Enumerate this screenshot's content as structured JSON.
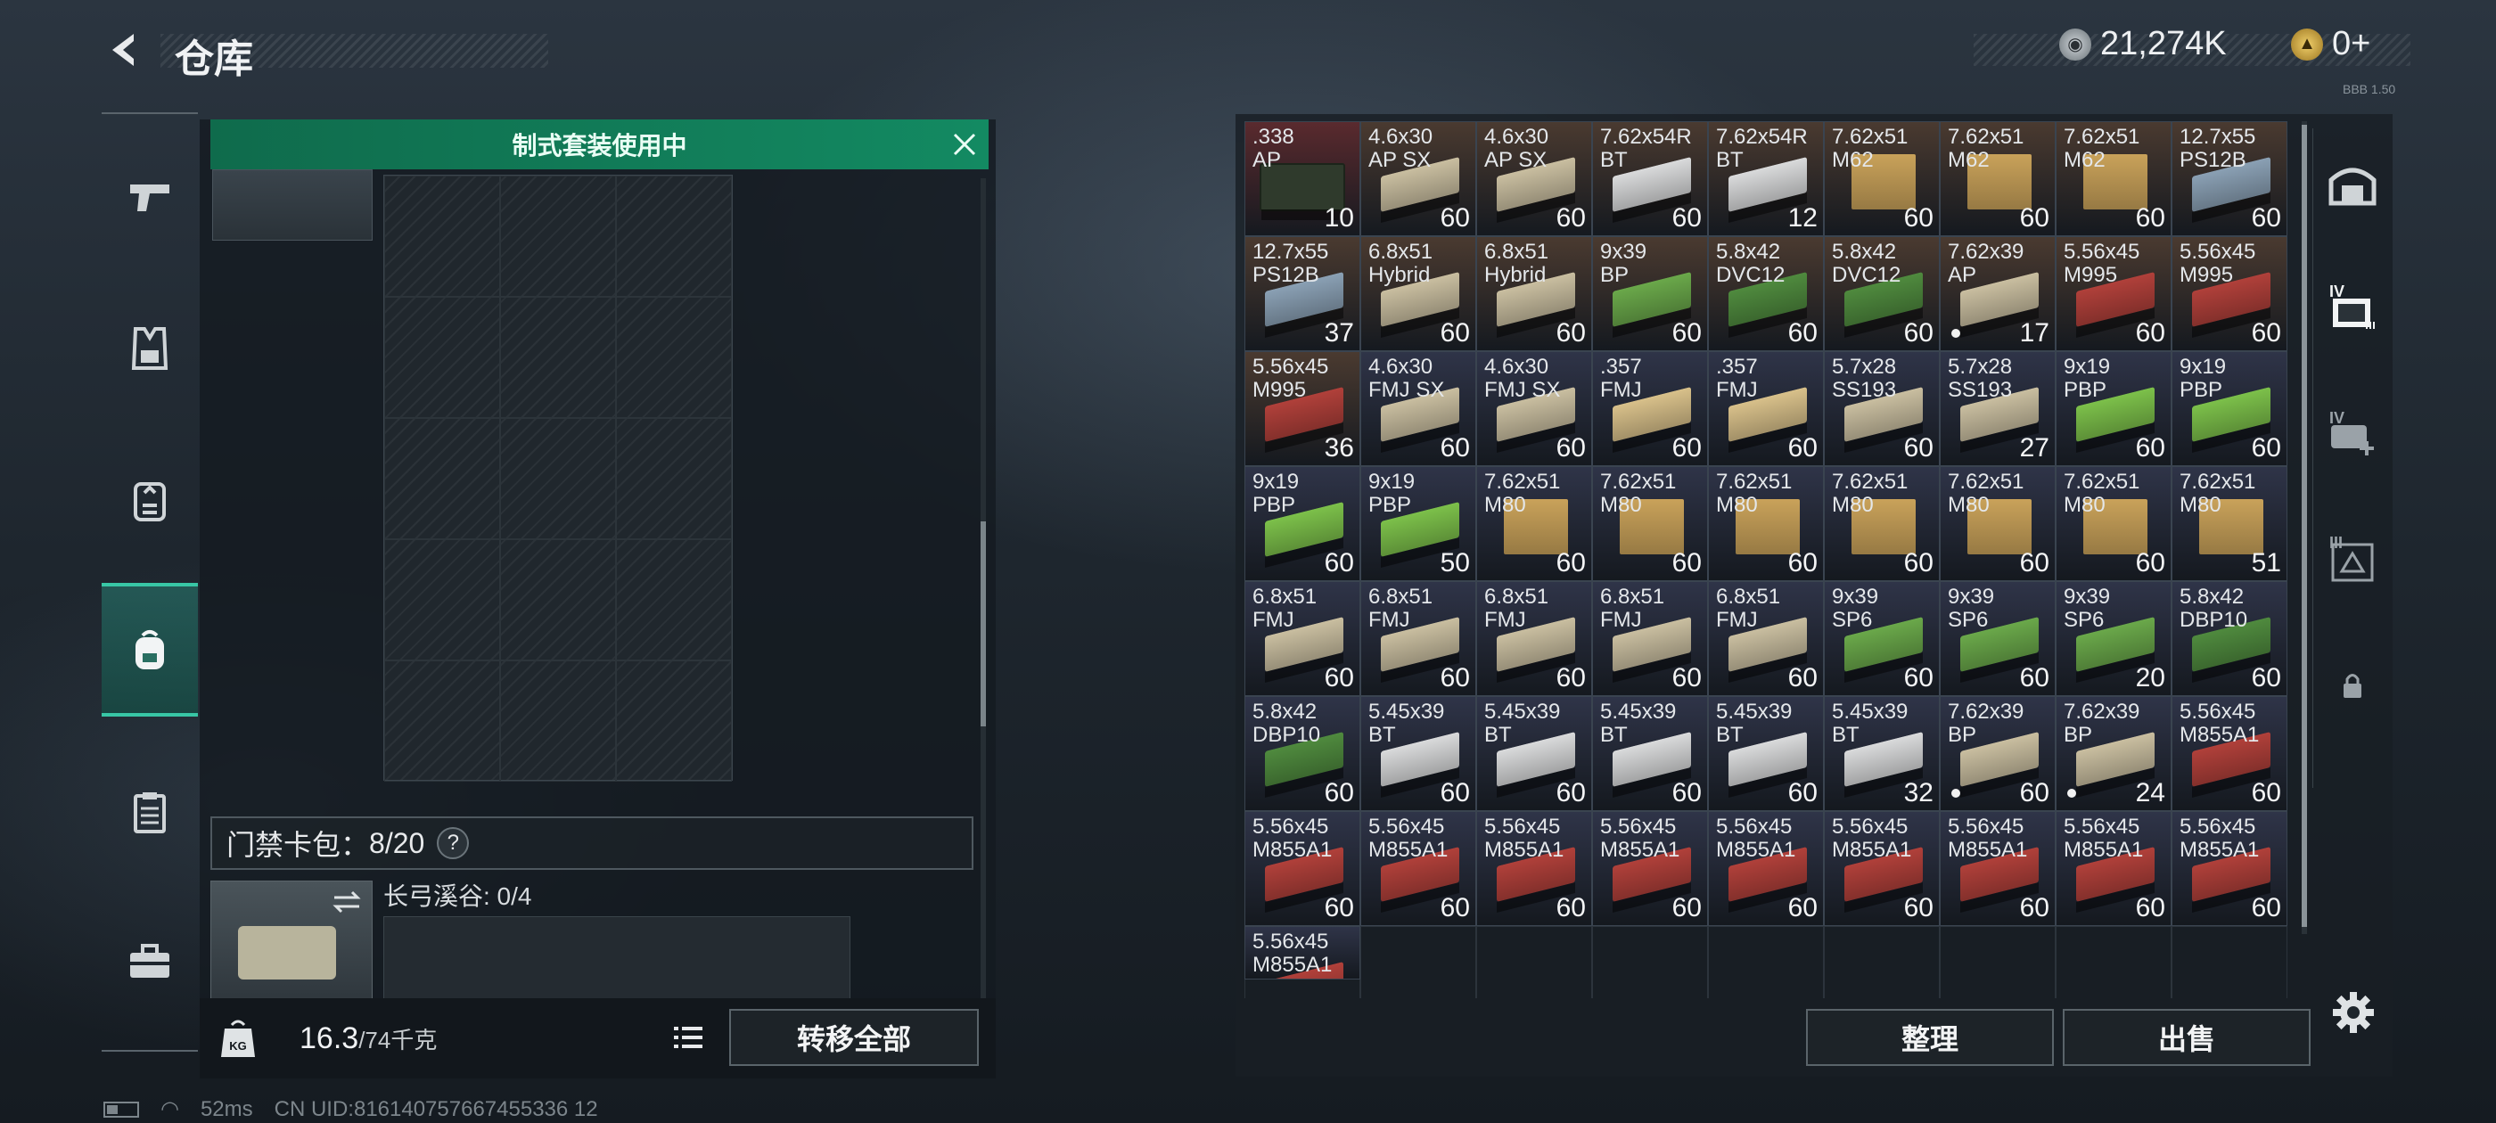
{
  "header": {
    "title": "仓库",
    "currency": [
      {
        "icon": "silver-coin-icon",
        "value": "21,274K"
      },
      {
        "icon": "gold-coin-icon",
        "value": "0+"
      }
    ],
    "version": "BBB 1.50"
  },
  "sidebar": {
    "items": [
      {
        "name": "weapon-tab",
        "icon": "pistol-icon"
      },
      {
        "name": "armor-tab",
        "icon": "vest-icon"
      },
      {
        "name": "rig-tab",
        "icon": "rig-icon"
      },
      {
        "name": "backpack-tab",
        "icon": "backpack-icon",
        "active": true
      },
      {
        "name": "case-tab",
        "icon": "case-icon"
      },
      {
        "name": "toolbox-tab",
        "icon": "toolbox-icon"
      }
    ]
  },
  "left_panel": {
    "banner": "制式套装使用中",
    "keycard_label": "门禁卡包：",
    "keycard_value": "8/20",
    "help": "?",
    "key_name": "长弓溪谷: 0/4",
    "weight_value": "16.3",
    "weight_unit": "/74千克",
    "weight_badge": "KG",
    "transfer_all": "转移全部"
  },
  "inventory": {
    "items": [
      {
        "l1": ".338",
        "l2": "AP",
        "n": "10",
        "c": "#2f3a2c",
        "bg": "#5a2a2e",
        "k": "ammocan"
      },
      {
        "l1": "4.6x30",
        "l2": "AP SX",
        "n": "60",
        "c": "#c9bea0",
        "bg": "#4a3a30"
      },
      {
        "l1": "4.6x30",
        "l2": "AP SX",
        "n": "60",
        "c": "#c9bea0",
        "bg": "#4a3a30"
      },
      {
        "l1": "7.62x54R",
        "l2": "BT",
        "n": "60",
        "c": "#d9dadb",
        "bg": "#4a3a30"
      },
      {
        "l1": "7.62x54R",
        "l2": "BT",
        "n": "12",
        "c": "#d9dadb",
        "bg": "#4a3a30"
      },
      {
        "l1": "7.62x51",
        "l2": "M62",
        "n": "60",
        "c": "#c9a25a",
        "bg": "#4a3a30",
        "k": "crate"
      },
      {
        "l1": "7.62x51",
        "l2": "M62",
        "n": "60",
        "c": "#c9a25a",
        "bg": "#4a3a30",
        "k": "crate"
      },
      {
        "l1": "7.62x51",
        "l2": "M62",
        "n": "60",
        "c": "#c9a25a",
        "bg": "#4a3a30",
        "k": "crate"
      },
      {
        "l1": "12.7x55",
        "l2": "PS12B",
        "n": "60",
        "c": "#8aa0b4",
        "bg": "#4a3a30"
      },
      {
        "l1": "12.7x55",
        "l2": "PS12B",
        "n": "37",
        "c": "#8aa0b4",
        "bg": "#4a3a30"
      },
      {
        "l1": "6.8x51",
        "l2": "Hybrid",
        "n": "60",
        "c": "#c9bea0",
        "bg": "#4a3a30"
      },
      {
        "l1": "6.8x51",
        "l2": "Hybrid",
        "n": "60",
        "c": "#c9bea0",
        "bg": "#4a3a30"
      },
      {
        "l1": "9x39",
        "l2": "BP",
        "n": "60",
        "c": "#6aa84a",
        "bg": "#4a3a30"
      },
      {
        "l1": "5.8x42",
        "l2": "DVC12",
        "n": "60",
        "c": "#4f8a3e",
        "bg": "#4a3a30"
      },
      {
        "l1": "5.8x42",
        "l2": "DVC12",
        "n": "60",
        "c": "#4f8a3e",
        "bg": "#4a3a30"
      },
      {
        "l1": "7.62x39",
        "l2": "AP",
        "n": "17",
        "c": "#c9bea0",
        "bg": "#4a3a30",
        "dot": true
      },
      {
        "l1": "5.56x45",
        "l2": "M995",
        "n": "60",
        "c": "#b0403a",
        "bg": "#4a3a30"
      },
      {
        "l1": "5.56x45",
        "l2": "M995",
        "n": "60",
        "c": "#b0403a",
        "bg": "#4a3a30"
      },
      {
        "l1": "5.56x45",
        "l2": "M995",
        "n": "36",
        "c": "#b0403a",
        "bg": "#4a3a30"
      },
      {
        "l1": "4.6x30",
        "l2": "FMJ SX",
        "n": "60",
        "c": "#c9bea0",
        "bg": "#2f3448"
      },
      {
        "l1": "4.6x30",
        "l2": "FMJ SX",
        "n": "60",
        "c": "#c9bea0",
        "bg": "#2f3448"
      },
      {
        "l1": ".357",
        "l2": "FMJ",
        "n": "60",
        "c": "#d8c08a",
        "bg": "#2f3448"
      },
      {
        "l1": ".357",
        "l2": "FMJ",
        "n": "60",
        "c": "#d8c08a",
        "bg": "#2f3448"
      },
      {
        "l1": "5.7x28",
        "l2": "SS193",
        "n": "60",
        "c": "#c9bea0",
        "bg": "#2f3448"
      },
      {
        "l1": "5.7x28",
        "l2": "SS193",
        "n": "27",
        "c": "#c9bea0",
        "bg": "#2f3448"
      },
      {
        "l1": "9x19",
        "l2": "PBP",
        "n": "60",
        "c": "#7cc04a",
        "bg": "#2f3448"
      },
      {
        "l1": "9x19",
        "l2": "PBP",
        "n": "60",
        "c": "#7cc04a",
        "bg": "#2f3448"
      },
      {
        "l1": "9x19",
        "l2": "PBP",
        "n": "60",
        "c": "#7cc04a",
        "bg": "#2f3448"
      },
      {
        "l1": "9x19",
        "l2": "PBP",
        "n": "50",
        "c": "#7cc04a",
        "bg": "#2f3448"
      },
      {
        "l1": "7.62x51",
        "l2": "M80",
        "n": "60",
        "c": "#c9a25a",
        "bg": "#2f3448",
        "k": "crate"
      },
      {
        "l1": "7.62x51",
        "l2": "M80",
        "n": "60",
        "c": "#c9a25a",
        "bg": "#2f3448",
        "k": "crate"
      },
      {
        "l1": "7.62x51",
        "l2": "M80",
        "n": "60",
        "c": "#c9a25a",
        "bg": "#2f3448",
        "k": "crate"
      },
      {
        "l1": "7.62x51",
        "l2": "M80",
        "n": "60",
        "c": "#c9a25a",
        "bg": "#2f3448",
        "k": "crate"
      },
      {
        "l1": "7.62x51",
        "l2": "M80",
        "n": "60",
        "c": "#c9a25a",
        "bg": "#2f3448",
        "k": "crate"
      },
      {
        "l1": "7.62x51",
        "l2": "M80",
        "n": "60",
        "c": "#c9a25a",
        "bg": "#2f3448",
        "k": "crate"
      },
      {
        "l1": "7.62x51",
        "l2": "M80",
        "n": "51",
        "c": "#c9a25a",
        "bg": "#2f3448",
        "k": "crate"
      },
      {
        "l1": "6.8x51",
        "l2": "FMJ",
        "n": "60",
        "c": "#c9bea0",
        "bg": "#2f3448"
      },
      {
        "l1": "6.8x51",
        "l2": "FMJ",
        "n": "60",
        "c": "#c9bea0",
        "bg": "#2f3448"
      },
      {
        "l1": "6.8x51",
        "l2": "FMJ",
        "n": "60",
        "c": "#c9bea0",
        "bg": "#2f3448"
      },
      {
        "l1": "6.8x51",
        "l2": "FMJ",
        "n": "60",
        "c": "#c9bea0",
        "bg": "#2f3448"
      },
      {
        "l1": "6.8x51",
        "l2": "FMJ",
        "n": "60",
        "c": "#c9bea0",
        "bg": "#2f3448"
      },
      {
        "l1": "9x39",
        "l2": "SP6",
        "n": "60",
        "c": "#6aa84a",
        "bg": "#2f3448"
      },
      {
        "l1": "9x39",
        "l2": "SP6",
        "n": "60",
        "c": "#6aa84a",
        "bg": "#2f3448"
      },
      {
        "l1": "9x39",
        "l2": "SP6",
        "n": "20",
        "c": "#6aa84a",
        "bg": "#2f3448"
      },
      {
        "l1": "5.8x42",
        "l2": "DBP10",
        "n": "60",
        "c": "#4f8a3e",
        "bg": "#2f3448"
      },
      {
        "l1": "5.8x42",
        "l2": "DBP10",
        "n": "60",
        "c": "#4f8a3e",
        "bg": "#2f3448"
      },
      {
        "l1": "5.45x39",
        "l2": "BT",
        "n": "60",
        "c": "#d9dadb",
        "bg": "#2f3448"
      },
      {
        "l1": "5.45x39",
        "l2": "BT",
        "n": "60",
        "c": "#d9dadb",
        "bg": "#2f3448"
      },
      {
        "l1": "5.45x39",
        "l2": "BT",
        "n": "60",
        "c": "#d9dadb",
        "bg": "#2f3448"
      },
      {
        "l1": "5.45x39",
        "l2": "BT",
        "n": "60",
        "c": "#d9dadb",
        "bg": "#2f3448"
      },
      {
        "l1": "5.45x39",
        "l2": "BT",
        "n": "32",
        "c": "#d9dadb",
        "bg": "#2f3448"
      },
      {
        "l1": "7.62x39",
        "l2": "BP",
        "n": "60",
        "c": "#c9bea0",
        "bg": "#2f3448",
        "dot": true
      },
      {
        "l1": "7.62x39",
        "l2": "BP",
        "n": "24",
        "c": "#c9bea0",
        "bg": "#2f3448",
        "dot": true
      },
      {
        "l1": "5.56x45",
        "l2": "M855A1",
        "n": "60",
        "c": "#b0403a",
        "bg": "#2f3448"
      },
      {
        "l1": "5.56x45",
        "l2": "M855A1",
        "n": "60",
        "c": "#b0403a",
        "bg": "#2f3448"
      },
      {
        "l1": "5.56x45",
        "l2": "M855A1",
        "n": "60",
        "c": "#b0403a",
        "bg": "#2f3448"
      },
      {
        "l1": "5.56x45",
        "l2": "M855A1",
        "n": "60",
        "c": "#b0403a",
        "bg": "#2f3448"
      },
      {
        "l1": "5.56x45",
        "l2": "M855A1",
        "n": "60",
        "c": "#b0403a",
        "bg": "#2f3448"
      },
      {
        "l1": "5.56x45",
        "l2": "M855A1",
        "n": "60",
        "c": "#b0403a",
        "bg": "#2f3448"
      },
      {
        "l1": "5.56x45",
        "l2": "M855A1",
        "n": "60",
        "c": "#b0403a",
        "bg": "#2f3448"
      },
      {
        "l1": "5.56x45",
        "l2": "M855A1",
        "n": "60",
        "c": "#b0403a",
        "bg": "#2f3448"
      },
      {
        "l1": "5.56x45",
        "l2": "M855A1",
        "n": "60",
        "c": "#b0403a",
        "bg": "#2f3448"
      },
      {
        "l1": "5.56x45",
        "l2": "M855A1",
        "n": "60",
        "c": "#b0403a",
        "bg": "#2f3448"
      },
      {
        "l1": "5.56x45",
        "l2": "M855A1",
        "n": "",
        "c": "#b0403a",
        "bg": "#2f3448"
      }
    ]
  },
  "right_panel": {
    "sort_button": "整理",
    "sell_button": "出售",
    "side_tabs": [
      {
        "name": "stash-icon"
      },
      {
        "name": "container-iv-icon",
        "active": true
      },
      {
        "name": "container-iv-add-icon"
      },
      {
        "name": "container-iii-icon"
      },
      {
        "name": "lock-icon"
      }
    ]
  },
  "status_bar": {
    "ping": "52ms",
    "uid": "CN UID:816140757667455336 12"
  },
  "colors": {
    "accent": "#138a62",
    "active_tab": "#38c7a6"
  }
}
